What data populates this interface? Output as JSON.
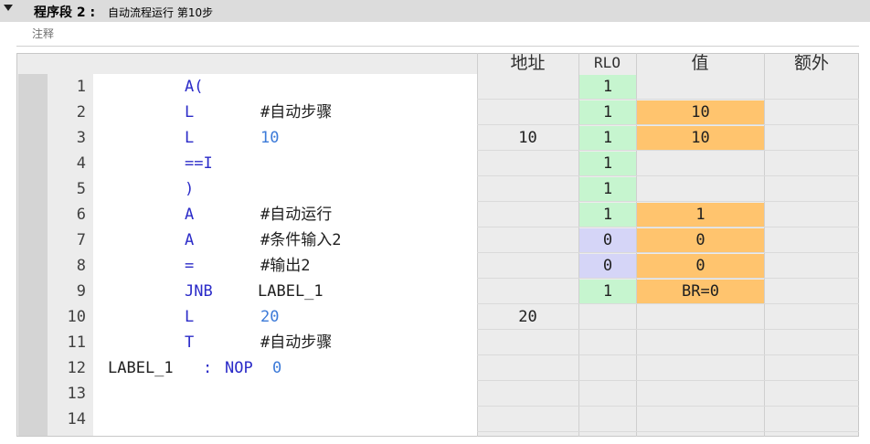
{
  "network": {
    "title": "程序段 2 :",
    "description": "自动流程运行 第10步",
    "comment_placeholder": "注释"
  },
  "columns": {
    "address": "地址",
    "rlo": "RLO",
    "value": "值",
    "extra": "额外"
  },
  "rows": [
    {
      "n": "1",
      "op": "A(",
      "arg": "",
      "addr": "",
      "rlo": "1",
      "val": ""
    },
    {
      "n": "2",
      "op": "L",
      "arg": "#自动步骤",
      "addr": "",
      "rlo": "1",
      "val": "10"
    },
    {
      "n": "3",
      "op": "L",
      "arg": "10",
      "addr": "10",
      "rlo": "1",
      "val": "10"
    },
    {
      "n": "4",
      "op": "==I",
      "arg": "",
      "addr": "",
      "rlo": "1",
      "val": ""
    },
    {
      "n": "5",
      "op": ")",
      "arg": "",
      "addr": "",
      "rlo": "1",
      "val": ""
    },
    {
      "n": "6",
      "op": "A",
      "arg": "#自动运行",
      "addr": "",
      "rlo": "1",
      "val": "1"
    },
    {
      "n": "7",
      "op": "A",
      "arg": "#条件输入2",
      "addr": "",
      "rlo": "0",
      "val": "0"
    },
    {
      "n": "8",
      "op": "=",
      "arg": "#输出2",
      "addr": "",
      "rlo": "0",
      "val": "0"
    },
    {
      "n": "9",
      "op": "JNB",
      "arg": "LABEL_1",
      "addr": "",
      "rlo": "1",
      "val": "BR=0"
    },
    {
      "n": "10",
      "op": "L",
      "arg": "20",
      "addr": "20",
      "rlo": "",
      "val": ""
    },
    {
      "n": "11",
      "op": "T",
      "arg": "#自动步骤",
      "addr": "",
      "rlo": "",
      "val": ""
    },
    {
      "n": "12",
      "label": "LABEL_1",
      "sep": ":",
      "op": "NOP",
      "arg": "0",
      "addr": "",
      "rlo": "",
      "val": ""
    },
    {
      "n": "13",
      "op": "",
      "arg": "",
      "addr": "",
      "rlo": "",
      "val": ""
    },
    {
      "n": "14",
      "op": "",
      "arg": "",
      "addr": "",
      "rlo": "",
      "val": ""
    }
  ],
  "colors": {
    "rlo_true": "#c6f5cf",
    "rlo_false": "#d5d5f7",
    "value_highlight": "#ffc46e",
    "keyword": "#2b2bc8",
    "constant": "#3c7ad8"
  }
}
